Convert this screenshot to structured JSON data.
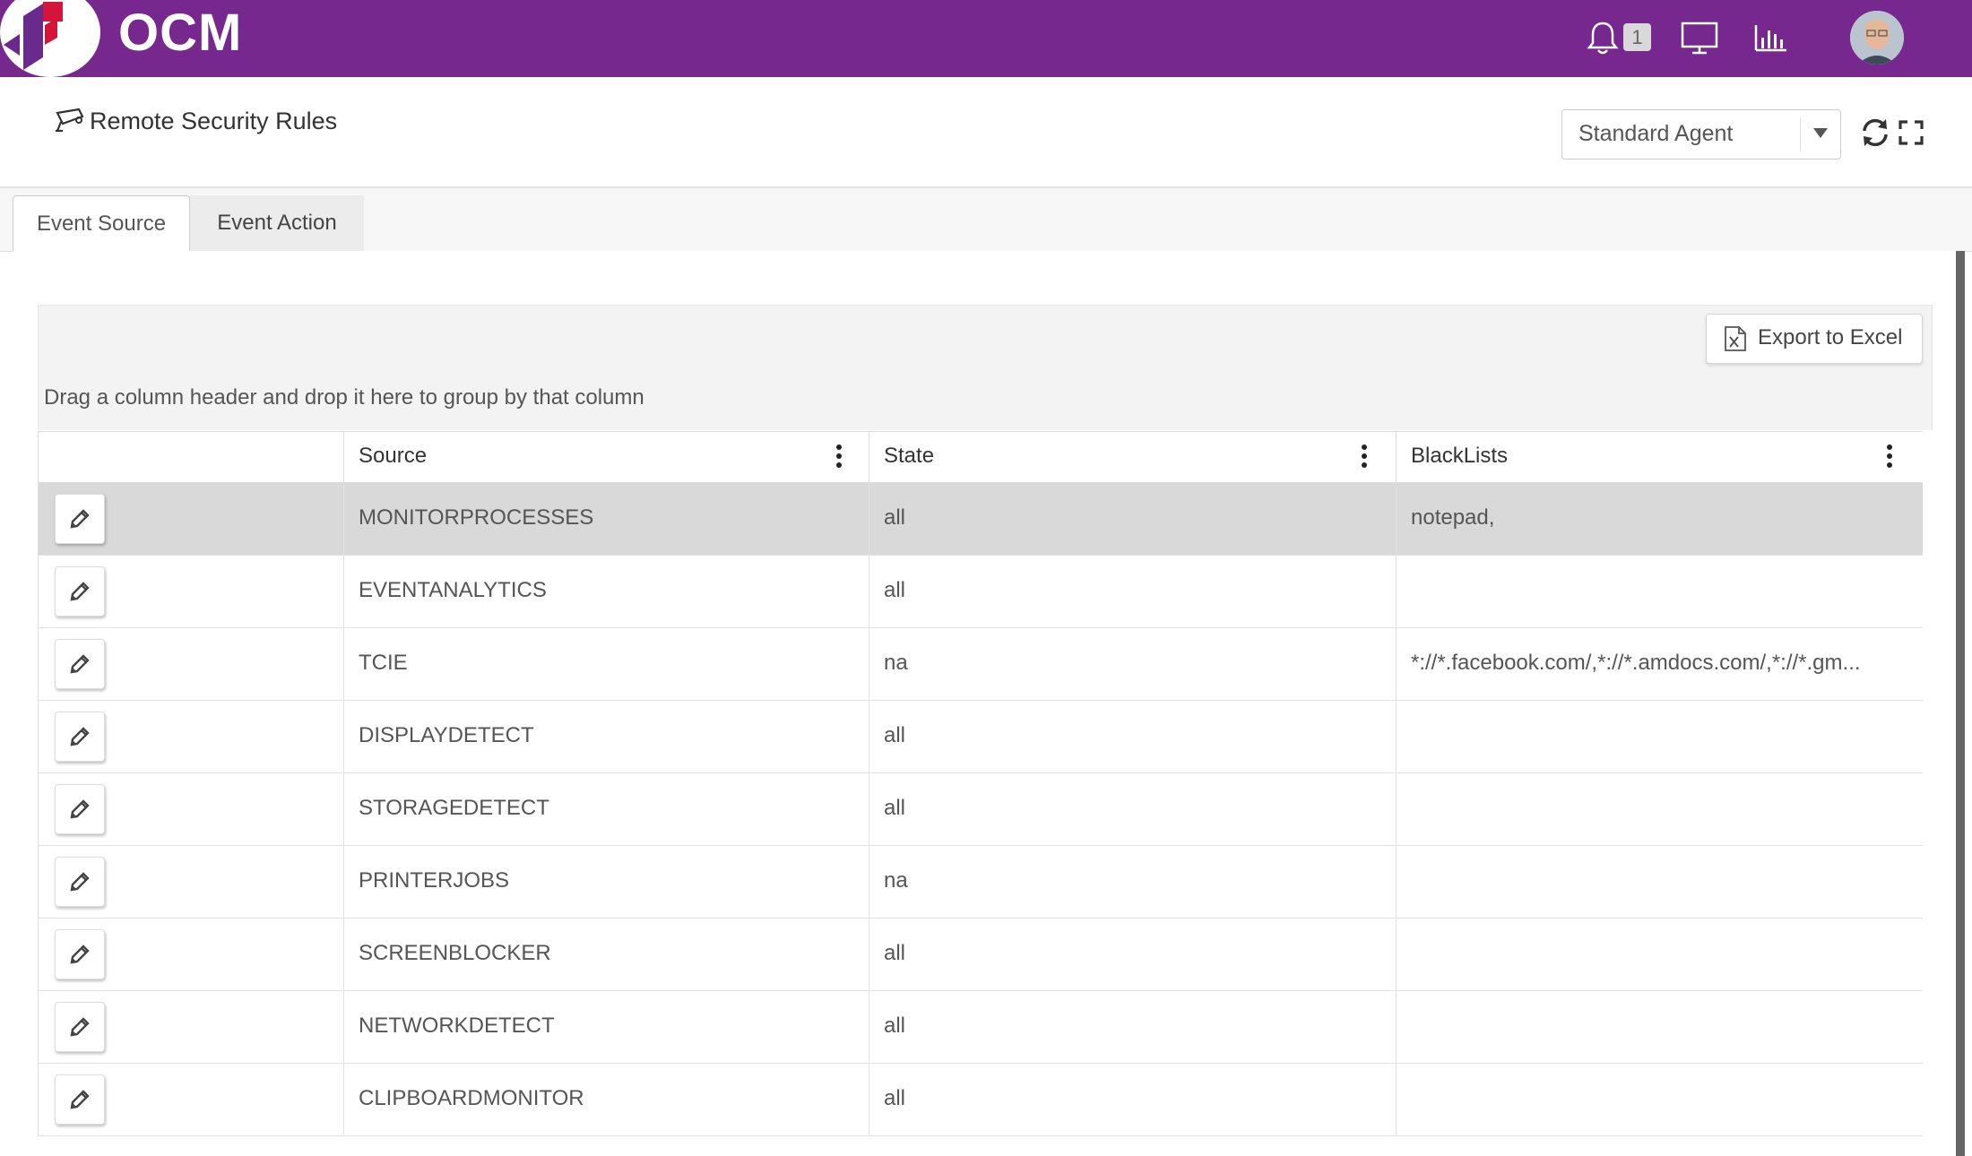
{
  "app": {
    "brand": "OCM",
    "notification_count": "1"
  },
  "page": {
    "title": "Remote Security Rules",
    "agent_select": {
      "value": "Standard Agent"
    }
  },
  "tabs": [
    {
      "label": "Event Source",
      "active": true
    },
    {
      "label": "Event Action",
      "active": false
    }
  ],
  "grid": {
    "export_label": "Export to Excel",
    "group_hint": "Drag a column header and drop it here to group by that column",
    "columns": [
      "Source",
      "State",
      "BlackLists"
    ],
    "rows": [
      {
        "source": "MONITORPROCESSES",
        "state": "all",
        "blacklists": "notepad,"
      },
      {
        "source": "EVENTANALYTICS",
        "state": "all",
        "blacklists": ""
      },
      {
        "source": "TCIE",
        "state": "na",
        "blacklists": "*://*.facebook.com/,*://*.amdocs.com/,*://*.gm..."
      },
      {
        "source": "DISPLAYDETECT",
        "state": "all",
        "blacklists": ""
      },
      {
        "source": "STORAGEDETECT",
        "state": "all",
        "blacklists": ""
      },
      {
        "source": "PRINTERJOBS",
        "state": "na",
        "blacklists": ""
      },
      {
        "source": "SCREENBLOCKER",
        "state": "all",
        "blacklists": ""
      },
      {
        "source": "NETWORKDETECT",
        "state": "all",
        "blacklists": ""
      },
      {
        "source": "CLIPBOARDMONITOR",
        "state": "all",
        "blacklists": ""
      }
    ]
  },
  "icons": {
    "bell": "bell-icon",
    "monitor": "monitor-icon",
    "chart": "bar-chart-icon",
    "refresh": "refresh-icon",
    "fullscreen": "fullscreen-icon",
    "edit": "pencil-icon",
    "excel": "excel-icon",
    "title": "security-camera-icon"
  },
  "colors": {
    "topbar": "#76288f",
    "logo_red": "#d4143b",
    "logo_purple": "#6a2a8c"
  }
}
